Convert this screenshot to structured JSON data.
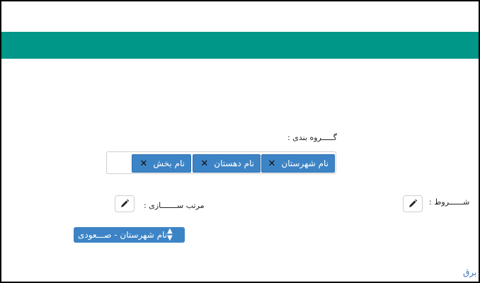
{
  "header": {
    "color": "#009688"
  },
  "grouping": {
    "label": "گـــــروه بندی :",
    "tags": [
      {
        "label": "نام شهرستان",
        "remove_icon": "close-icon"
      },
      {
        "label": "نام دهستان",
        "remove_icon": "close-icon"
      },
      {
        "label": "نام بخش",
        "remove_icon": "close-icon"
      }
    ]
  },
  "conditions": {
    "label": "شــــــروط :",
    "edit_icon": "pencil-icon"
  },
  "sorting": {
    "label": "مرتب ســـــــازی :",
    "edit_icon": "pencil-icon"
  },
  "sort_select": {
    "value": "نام شهرستان - صـــعودی"
  },
  "footer": {
    "link_text": "برق"
  },
  "colors": {
    "accent": "#3d84c6",
    "teal": "#009688"
  }
}
